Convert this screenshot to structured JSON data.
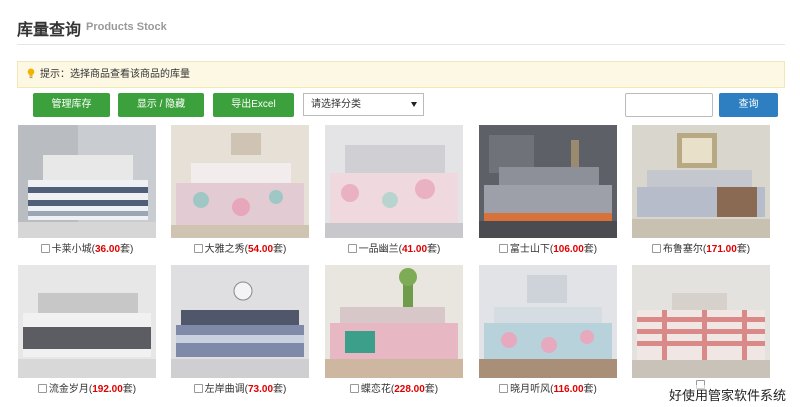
{
  "header": {
    "title": "库量查询",
    "subtitle": "Products Stock"
  },
  "tip": {
    "text": "提示：选择商品查看该商品的库量",
    "icon": "lightbulb-icon"
  },
  "toolbar": {
    "manage_label": "管理库存",
    "toggle_label": "显示 / 隐藏",
    "export_label": "导出Excel",
    "category_selected": "请选择分类",
    "search_value": "",
    "search_label": "查询"
  },
  "colors": {
    "green_button": "#3ca13c",
    "blue_button": "#2e7fc1",
    "count_red": "#e00000",
    "tip_bg": "#fcf8e3"
  },
  "products": [
    {
      "name": "卡莱小城",
      "count": "36.00",
      "unit": "套",
      "checked": false
    },
    {
      "name": "大雅之秀",
      "count": "54.00",
      "unit": "套",
      "checked": false
    },
    {
      "name": "一品幽兰",
      "count": "41.00",
      "unit": "套",
      "checked": false
    },
    {
      "name": "富士山下",
      "count": "106.00",
      "unit": "套",
      "checked": false
    },
    {
      "name": "布鲁塞尔",
      "count": "171.00",
      "unit": "套",
      "checked": false
    },
    {
      "name": "流金岁月",
      "count": "192.00",
      "unit": "套",
      "checked": false
    },
    {
      "name": "左岸曲调",
      "count": "73.00",
      "unit": "套",
      "checked": false
    },
    {
      "name": "蝶恋花",
      "count": "228.00",
      "unit": "套",
      "checked": false
    },
    {
      "name": "晓月听风",
      "count": "116.00",
      "unit": "套",
      "checked": false
    },
    {
      "name": "",
      "count": "",
      "unit": "",
      "checked": false
    }
  ],
  "watermark": "好使用管家软件系统"
}
